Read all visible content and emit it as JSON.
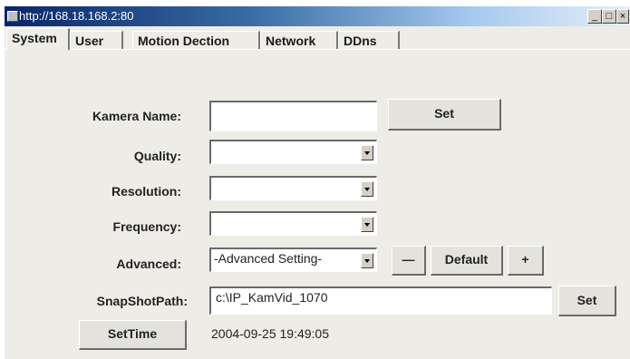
{
  "window": {
    "title": "http://168.18.168.2:80",
    "controls": {
      "minimize": "_",
      "maximize": "□",
      "close": "×"
    }
  },
  "tabs": [
    {
      "label": "System",
      "active": true
    },
    {
      "label": "User"
    },
    {
      "label": "Motion Dection"
    },
    {
      "label": "Network"
    },
    {
      "label": "DDns"
    }
  ],
  "form": {
    "kamera_name": {
      "label": "Kamera Name:",
      "value": "",
      "set_label": "Set"
    },
    "quality": {
      "label": "Quality:",
      "value": ""
    },
    "resolution": {
      "label": "Resolution:",
      "value": ""
    },
    "frequency": {
      "label": "Frequency:",
      "value": ""
    },
    "advanced": {
      "label": "Advanced:",
      "value": "-Advanced Setting-",
      "minus_label": "—",
      "default_label": "Default",
      "plus_label": "+"
    },
    "snapshot": {
      "label": "SnapShotPath:",
      "value": "c:\\IP_KamVid_1070",
      "set_label": "Set"
    },
    "time": {
      "button_label": "SetTime",
      "value": "2004-09-25 19:49:05"
    }
  }
}
